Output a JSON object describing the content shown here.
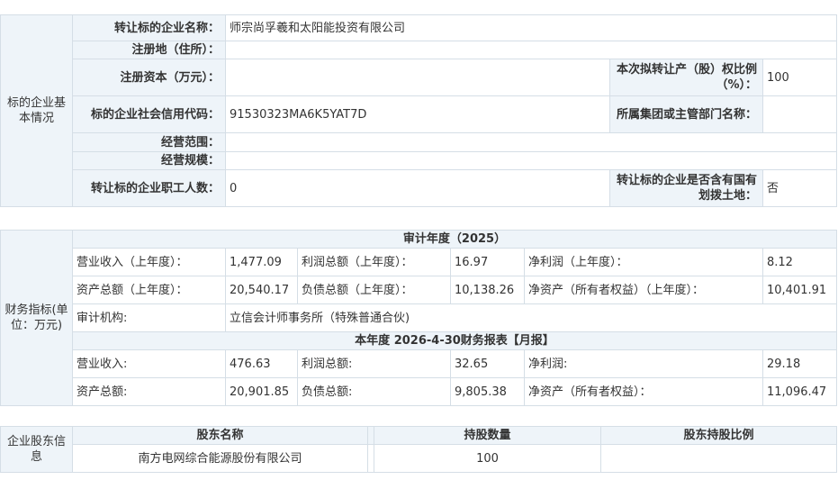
{
  "basic": {
    "section_label": "标的企业基本情况",
    "name_label": "转让标的企业名称：",
    "name_value": "师宗尚孚羲和太阳能投资有限公司",
    "address_label": "注册地（住所）：",
    "address_value": "",
    "capital_label": "注册资本（万元）：",
    "capital_value": "",
    "ratio_label": "本次拟转让产（股）权比例（%）：",
    "ratio_value": "100",
    "credit_label": "标的企业社会信用代码：",
    "credit_value": "91530323MA6K5YAT7D",
    "group_label": "所属集团或主管部门名称：",
    "group_value": "",
    "scope_label": "经营范围：",
    "scope_value": "",
    "scale_label": "经营规模：",
    "scale_value": "",
    "staff_label": "转让标的企业职工人数：",
    "staff_value": "0",
    "land_label": "转让标的企业是否含有国有划拨土地：",
    "land_value": "否"
  },
  "finance": {
    "section_label": "财务指标(单位：万元)",
    "audit_header": "审计年度（2025）",
    "audit_row1": {
      "revenue_label": "营业收入（上年度）：",
      "revenue_value": "1,477.09",
      "profit_label": "利润总额（上年度）：",
      "profit_value": "16.97",
      "net_profit_label": "净利润（上年度）：",
      "net_profit_value": "8.12"
    },
    "audit_row2": {
      "assets_label": "资产总额（上年度）：",
      "assets_value": "20,540.17",
      "liabilities_label": "负债总额（上年度）：",
      "liabilities_value": "10,138.26",
      "equity_label": "净资产（所有者权益）（上年度）：",
      "equity_value": "10,401.91"
    },
    "auditor_label": "审计机构:",
    "auditor_value": "立信会计师事务所（特殊普通合伙)",
    "current_header": "本年度 2026-4-30财务报表【月报】",
    "current_row1": {
      "revenue_label": "营业收入:",
      "revenue_value": "476.63",
      "profit_label": "利润总额:",
      "profit_value": "32.65",
      "net_profit_label": "净利润:",
      "net_profit_value": "29.18"
    },
    "current_row2": {
      "assets_label": "资产总额:",
      "assets_value": "20,901.85",
      "liabilities_label": "负债总额:",
      "liabilities_value": "9,805.38",
      "equity_label": "净资产（所有者权益）：",
      "equity_value": "11,096.47"
    }
  },
  "shareholders": {
    "section_label": "企业股东信息",
    "col_name": "股东名称",
    "col_shares": "持股数量",
    "col_ratio": "股东持股比例",
    "rows": [
      {
        "name": "南方电网综合能源股份有限公司",
        "shares": "100",
        "ratio": ""
      }
    ]
  },
  "colors": {
    "label_bg": "#eef4f9",
    "border": "#d5dee6",
    "text": "#333333"
  }
}
